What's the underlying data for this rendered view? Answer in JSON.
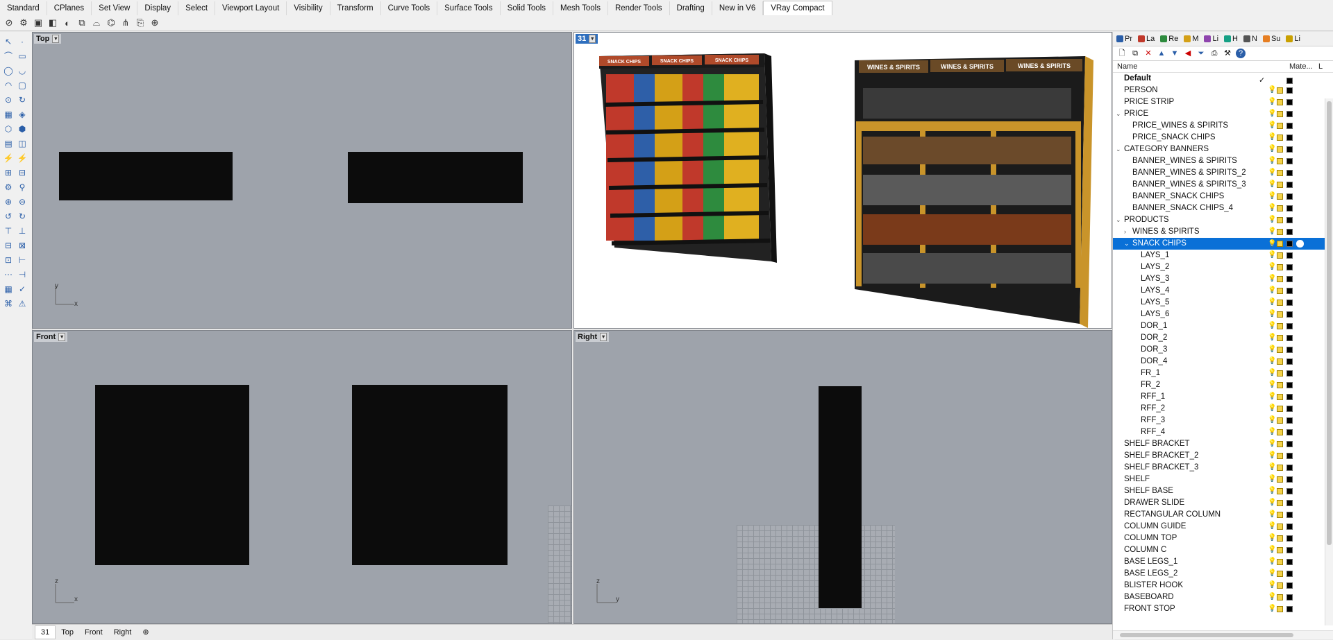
{
  "toolbar_tabs": [
    "Standard",
    "CPlanes",
    "Set View",
    "Display",
    "Select",
    "Viewport Layout",
    "Visibility",
    "Transform",
    "Curve Tools",
    "Surface Tools",
    "Solid Tools",
    "Mesh Tools",
    "Render Tools",
    "Drafting",
    "New in V6",
    "VRay Compact"
  ],
  "active_toolbar_tab": "VRay Compact",
  "viewports": {
    "top": {
      "label": "Top",
      "axis_v": "y",
      "axis_h": "x"
    },
    "perspective": {
      "label": "31"
    },
    "front": {
      "label": "Front",
      "axis_v": "z",
      "axis_h": "x"
    },
    "right": {
      "label": "Right",
      "axis_v": "z",
      "axis_h": "y"
    }
  },
  "render_labels": {
    "snack_banner": [
      "SNACK CHIPS",
      "SNACK CHIPS",
      "SNACK CHIPS"
    ],
    "wine_banner": [
      "WINES & SPIRITS",
      "WINES & SPIRITS",
      "WINES & SPIRITS"
    ]
  },
  "bottom_tabs": [
    "31",
    "Top",
    "Front",
    "Right"
  ],
  "active_bottom_tab": "31",
  "panel": {
    "tabs": [
      "Pr",
      "La",
      "Re",
      "M",
      "Li",
      "H",
      "N",
      "Su",
      "Li"
    ],
    "col_name": "Name",
    "col_material": "Mate...",
    "col_linetype": "L"
  },
  "layers": [
    {
      "name": "Default",
      "level": 0,
      "bold": true,
      "current": true
    },
    {
      "name": "PERSON",
      "level": 0
    },
    {
      "name": "PRICE STRIP",
      "level": 0
    },
    {
      "name": "PRICE",
      "level": 0,
      "twisty": "v"
    },
    {
      "name": "PRICE_WINES & SPIRITS",
      "level": 1
    },
    {
      "name": "PRICE_SNACK CHIPS",
      "level": 1
    },
    {
      "name": "CATEGORY BANNERS",
      "level": 0,
      "twisty": "v"
    },
    {
      "name": "BANNER_WINES & SPIRITS",
      "level": 1
    },
    {
      "name": "BANNER_WINES & SPIRITS_2",
      "level": 1
    },
    {
      "name": "BANNER_WINES & SPIRITS_3",
      "level": 1
    },
    {
      "name": "BANNER_SNACK CHIPS",
      "level": 1
    },
    {
      "name": "BANNER_SNACK CHIPS_4",
      "level": 1
    },
    {
      "name": "PRODUCTS",
      "level": 0,
      "twisty": "v"
    },
    {
      "name": "WINES & SPIRITS",
      "level": 1,
      "twisty": ">"
    },
    {
      "name": "SNACK CHIPS",
      "level": 1,
      "twisty": "v",
      "selected": true
    },
    {
      "name": "LAYS_1",
      "level": 2
    },
    {
      "name": "LAYS_2",
      "level": 2
    },
    {
      "name": "LAYS_3",
      "level": 2
    },
    {
      "name": "LAYS_4",
      "level": 2
    },
    {
      "name": "LAYS_5",
      "level": 2
    },
    {
      "name": "LAYS_6",
      "level": 2
    },
    {
      "name": "DOR_1",
      "level": 2
    },
    {
      "name": "DOR_2",
      "level": 2
    },
    {
      "name": "DOR_3",
      "level": 2
    },
    {
      "name": "DOR_4",
      "level": 2
    },
    {
      "name": "FR_1",
      "level": 2
    },
    {
      "name": "FR_2",
      "level": 2
    },
    {
      "name": "RFF_1",
      "level": 2
    },
    {
      "name": "RFF_2",
      "level": 2
    },
    {
      "name": "RFF_3",
      "level": 2
    },
    {
      "name": "RFF_4",
      "level": 2
    },
    {
      "name": "SHELF BRACKET",
      "level": 0
    },
    {
      "name": "SHELF BRACKET_2",
      "level": 0
    },
    {
      "name": "SHELF BRACKET_3",
      "level": 0
    },
    {
      "name": "SHELF",
      "level": 0
    },
    {
      "name": "SHELF BASE",
      "level": 0
    },
    {
      "name": "DRAWER SLIDE",
      "level": 0
    },
    {
      "name": "RECTANGULAR COLUMN",
      "level": 0
    },
    {
      "name": "COLUMN GUIDE",
      "level": 0
    },
    {
      "name": "COLUMN TOP",
      "level": 0
    },
    {
      "name": "COLUMN C",
      "level": 0
    },
    {
      "name": "BASE LEGS_1",
      "level": 0
    },
    {
      "name": "BASE LEGS_2",
      "level": 0
    },
    {
      "name": "BLISTER HOOK",
      "level": 0
    },
    {
      "name": "BASEBOARD",
      "level": 0
    },
    {
      "name": "FRONT STOP",
      "level": 0
    }
  ]
}
